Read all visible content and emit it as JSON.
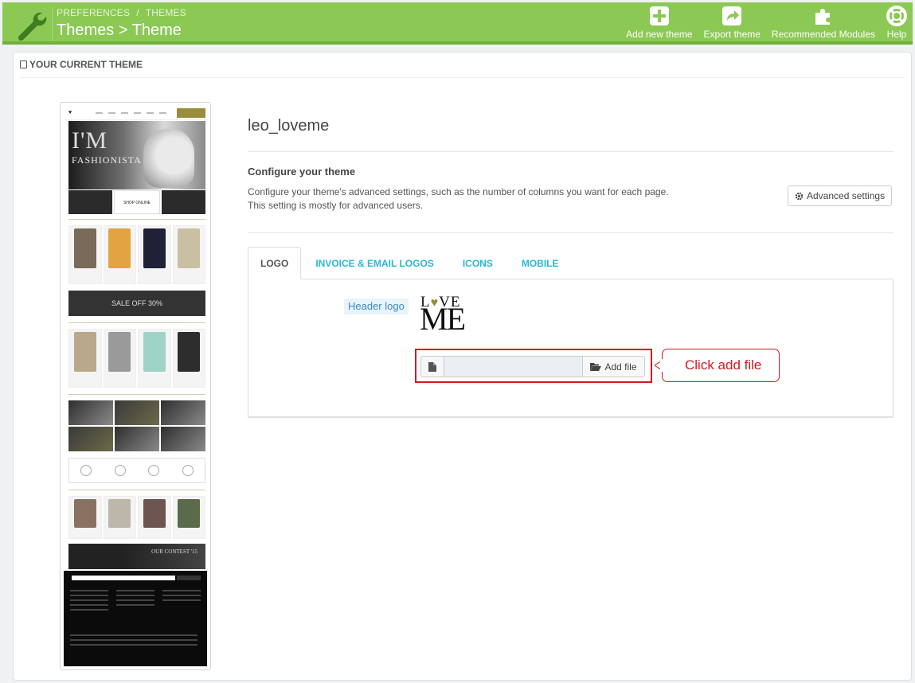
{
  "header": {
    "breadcrumb": [
      "PREFERENCES",
      "THEMES"
    ],
    "breadcrumb_sep": "/",
    "title": "Themes > Theme",
    "toolbar": [
      {
        "label": "Add new theme",
        "icon": "plus-square-icon"
      },
      {
        "label": "Export theme",
        "icon": "share-icon"
      },
      {
        "label": "Recommended Modules",
        "icon": "puzzle-icon"
      },
      {
        "label": "Help",
        "icon": "lifebuoy-icon"
      }
    ],
    "colors": {
      "bar": "#8bc954",
      "bar_border": "#6fb13a"
    }
  },
  "panel": {
    "heading": "YOUR CURRENT THEME"
  },
  "preview": {
    "hero_line1": "I'M",
    "hero_line2": "FASHIONISTA",
    "banner_text": "SHOP ONLINE",
    "sale_text": "SALE OFF 30%",
    "contest_text": "OUR CONTEST '15"
  },
  "theme": {
    "name": "leo_loveme",
    "configure_title": "Configure your theme",
    "configure_desc": "Configure your theme's advanced settings, such as the number of columns you want for each page. This setting is mostly for advanced users.",
    "advanced_button": "Advanced settings"
  },
  "tabs": [
    {
      "label": "LOGO",
      "active": true
    },
    {
      "label": "INVOICE & EMAIL LOGOS",
      "active": false
    },
    {
      "label": "ICONS",
      "active": false
    },
    {
      "label": "MOBILE",
      "active": false
    }
  ],
  "logo_tab": {
    "label": "Header logo",
    "logo_top": "L",
    "logo_top_rest": "VE",
    "logo_heart": "♥",
    "logo_bottom": "ME",
    "file_value": "",
    "add_file_label": "Add file"
  },
  "annotation": {
    "callout_text": "Click add file",
    "color": "#d5181f"
  }
}
